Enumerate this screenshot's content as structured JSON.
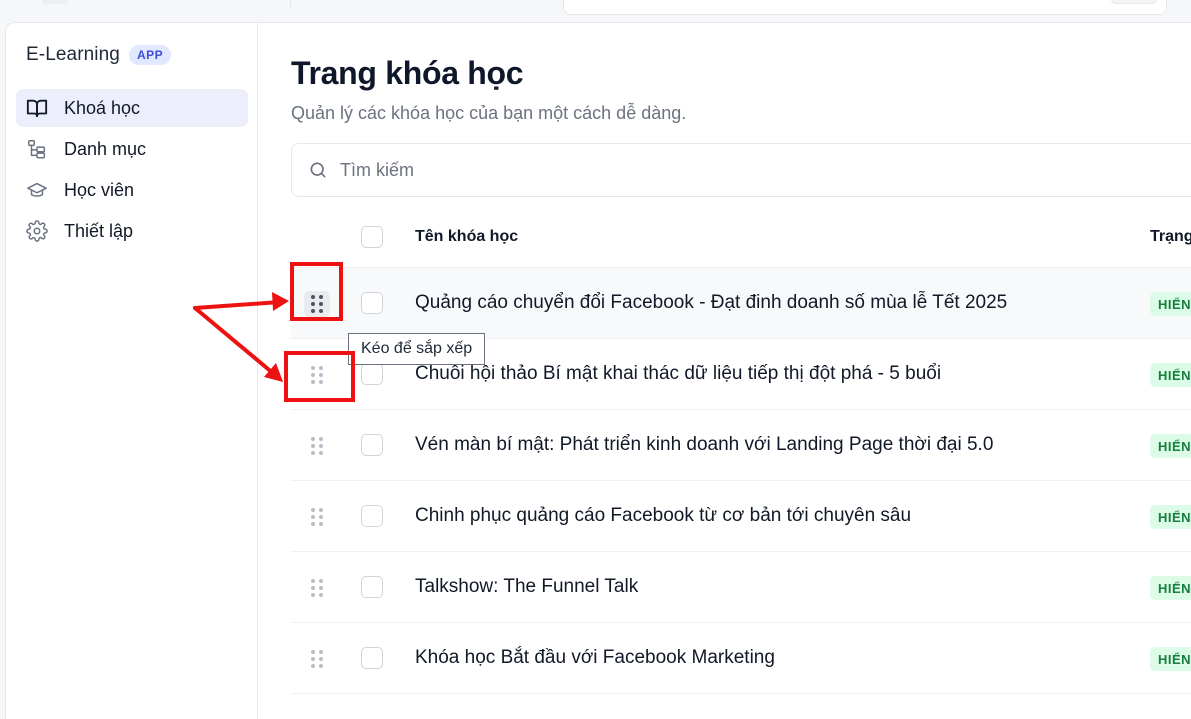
{
  "brand": {
    "name": "E-Learning",
    "badge": "APP"
  },
  "nav": [
    {
      "label": "Khoá học",
      "icon": "book-open-icon",
      "active": true
    },
    {
      "label": "Danh mục",
      "icon": "category-tree-icon",
      "active": false
    },
    {
      "label": "Học viên",
      "icon": "graduation-cap-icon",
      "active": false
    },
    {
      "label": "Thiết lập",
      "icon": "gear-icon",
      "active": false
    }
  ],
  "page": {
    "title": "Trang khóa học",
    "subtitle": "Quản lý các khóa học của bạn một cách dễ dàng."
  },
  "search": {
    "placeholder": "Tìm kiếm"
  },
  "table": {
    "col_name": "Tên khóa học",
    "col_status": "Trạng",
    "rows": [
      {
        "title": "Quảng cáo chuyển đổi Facebook - Đạt đinh doanh số mùa lễ Tết 2025",
        "status": "HIỂN"
      },
      {
        "title": "Chuỗi hội thảo Bí mật khai thác dữ liệu tiếp thị đột phá - 5 buổi",
        "status": "HIỂN"
      },
      {
        "title": "Vén màn bí mật: Phát triển kinh doanh với Landing Page thời đại 5.0",
        "status": "HIỂN"
      },
      {
        "title": "Chinh phục quảng cáo Facebook từ cơ bản tới chuyên sâu",
        "status": "HIỂN"
      },
      {
        "title": "Talkshow: The Funnel Talk",
        "status": "HIỂN"
      },
      {
        "title": "Khóa học Bắt đầu với Facebook Marketing",
        "status": "HIỂN"
      }
    ]
  },
  "tooltip": {
    "text": "Kéo để sắp xếp"
  },
  "colors": {
    "accent": "#eceefb",
    "badge_bg": "#dcfce7",
    "badge_text": "#15803d",
    "annotation": "#ee1111"
  }
}
